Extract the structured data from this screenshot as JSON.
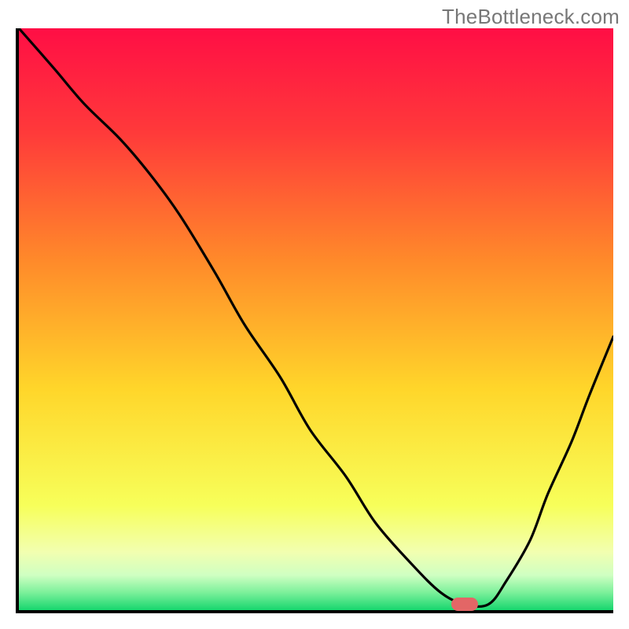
{
  "watermark": "TheBottleneck.com",
  "chart_data": {
    "type": "line",
    "title": "",
    "xlabel": "",
    "ylabel": "",
    "xlim": [
      0,
      100
    ],
    "ylim": [
      0,
      100
    ],
    "grid": false,
    "legend": false,
    "gradient_stops": [
      {
        "offset": 0,
        "color": "#ff0e45"
      },
      {
        "offset": 18,
        "color": "#ff3a3a"
      },
      {
        "offset": 40,
        "color": "#ff8a2a"
      },
      {
        "offset": 62,
        "color": "#ffd62a"
      },
      {
        "offset": 82,
        "color": "#f7ff5a"
      },
      {
        "offset": 90,
        "color": "#f2ffb0"
      },
      {
        "offset": 94,
        "color": "#cfffc2"
      },
      {
        "offset": 97,
        "color": "#7bf09a"
      },
      {
        "offset": 100,
        "color": "#17d66e"
      }
    ],
    "series": [
      {
        "name": "bottleneck-curve",
        "x": [
          0,
          6,
          11,
          17,
          22,
          27,
          33,
          38,
          44,
          49,
          55,
          60,
          66,
          71,
          75,
          79,
          82,
          86,
          89,
          93,
          96,
          100
        ],
        "values": [
          100,
          93,
          87,
          81,
          75,
          68,
          58,
          49,
          40,
          31,
          23,
          15,
          8,
          3,
          1,
          1,
          5,
          12,
          20,
          29,
          37,
          47
        ]
      }
    ],
    "marker": {
      "x": 75,
      "y": 1,
      "w": 4.5,
      "h": 2.2,
      "color": "#e36666"
    }
  }
}
